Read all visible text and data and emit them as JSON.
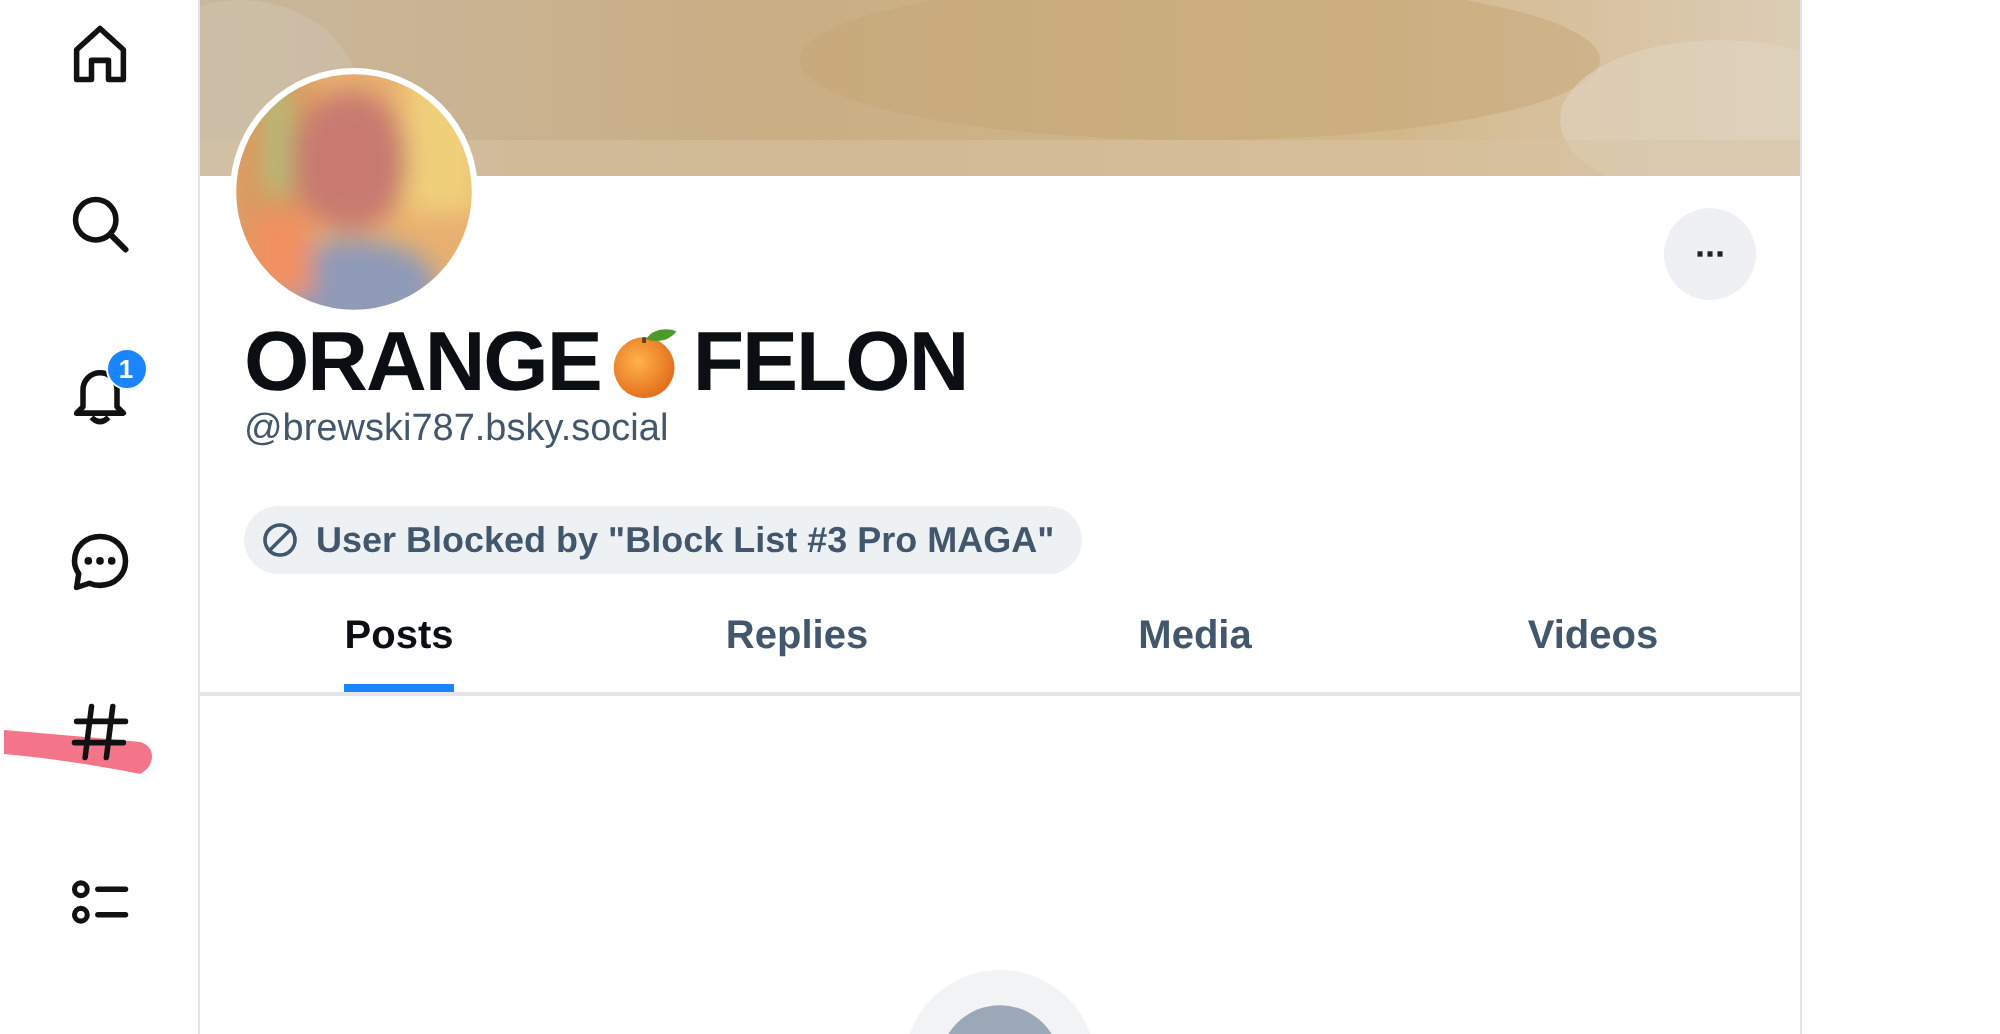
{
  "sidebar": {
    "items": [
      {
        "kind": "home"
      },
      {
        "kind": "search"
      },
      {
        "kind": "notifications",
        "badge": "1"
      },
      {
        "kind": "chat"
      },
      {
        "kind": "feeds",
        "highlighted": true
      },
      {
        "kind": "lists"
      }
    ]
  },
  "profile": {
    "more_button": "···",
    "name_before": "ORANGE",
    "name_after": "FELON",
    "handle": "@brewski787.bsky.social",
    "blocked_notice": "User Blocked by \"Block List #3 Pro MAGA\""
  },
  "tabs": [
    {
      "label": "Posts",
      "selected": true
    },
    {
      "label": "Replies",
      "selected": false
    },
    {
      "label": "Media",
      "selected": false
    },
    {
      "label": "Videos",
      "selected": false
    }
  ]
}
